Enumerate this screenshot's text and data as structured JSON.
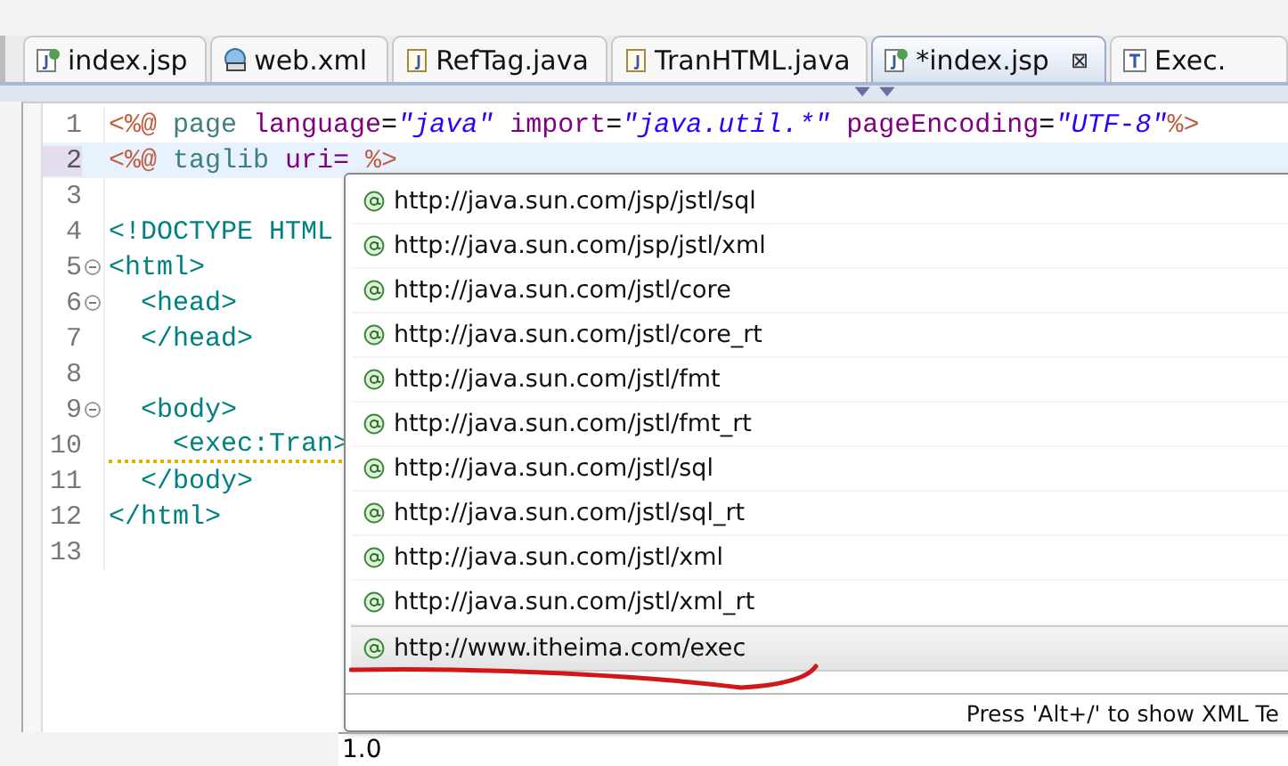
{
  "tabs": [
    {
      "label": "index.jsp",
      "kind": "jsp",
      "selected": false
    },
    {
      "label": "web.xml",
      "kind": "xml",
      "selected": false
    },
    {
      "label": "RefTag.java",
      "kind": "java",
      "selected": false
    },
    {
      "label": "TranHTML.java",
      "kind": "java",
      "selected": false
    },
    {
      "label": "*index.jsp",
      "kind": "jsp",
      "selected": true,
      "close": "⊠"
    },
    {
      "label": "Exec.",
      "kind": "tag",
      "selected": false
    }
  ],
  "editor": {
    "lines": [
      {
        "number": "1",
        "current": false,
        "foldable": false,
        "warning": false,
        "tokens": [
          {
            "kind": "delim",
            "text": "<%@"
          },
          {
            "kind": "directive",
            "text": " page"
          },
          {
            "kind": "attr",
            "text": " language"
          },
          {
            "kind": "plain",
            "text": "="
          },
          {
            "kind": "value",
            "text": "\"java\""
          },
          {
            "kind": "attr",
            "text": " import"
          },
          {
            "kind": "plain",
            "text": "="
          },
          {
            "kind": "value",
            "text": "\"java.util.*\""
          },
          {
            "kind": "attr",
            "text": " pageEncoding"
          },
          {
            "kind": "plain",
            "text": "="
          },
          {
            "kind": "value",
            "text": "\"UTF-8\""
          },
          {
            "kind": "delim",
            "text": "%>"
          }
        ]
      },
      {
        "number": "2",
        "current": true,
        "foldable": false,
        "warning": false,
        "tokens": [
          {
            "kind": "delim",
            "text": "<%@"
          },
          {
            "kind": "directive",
            "text": " taglib"
          },
          {
            "kind": "attr",
            "text": " uri="
          },
          {
            "kind": "delim",
            "text": " %>"
          }
        ]
      },
      {
        "number": "3",
        "current": false,
        "foldable": false
      },
      {
        "number": "4",
        "current": false,
        "foldable": false,
        "warning": false,
        "tokens": [
          {
            "kind": "tag",
            "text": "<!DOCTYPE HTML"
          }
        ]
      },
      {
        "number": "5",
        "current": false,
        "foldable": true,
        "warning": false,
        "tokens": [
          {
            "kind": "tag",
            "text": "<html>"
          }
        ]
      },
      {
        "number": "6",
        "current": false,
        "foldable": true,
        "warning": false,
        "tokens": [
          {
            "kind": "tag",
            "text": "  <head>"
          }
        ]
      },
      {
        "number": "7",
        "current": false,
        "foldable": false,
        "warning": false,
        "tokens": [
          {
            "kind": "tag",
            "text": "  </head>"
          }
        ]
      },
      {
        "number": "8",
        "current": false,
        "foldable": false
      },
      {
        "number": "9",
        "current": false,
        "foldable": true,
        "warning": false,
        "tokens": [
          {
            "kind": "tag",
            "text": "  <body>"
          }
        ]
      },
      {
        "number": "10",
        "current": false,
        "foldable": false,
        "warning": true,
        "tokens": [
          {
            "kind": "tag",
            "text": "    <exec:Tran>"
          }
        ]
      },
      {
        "number": "11",
        "current": false,
        "foldable": false,
        "warning": false,
        "tokens": [
          {
            "kind": "tag",
            "text": "  </body>"
          }
        ]
      },
      {
        "number": "12",
        "current": false,
        "foldable": false,
        "warning": false,
        "tokens": [
          {
            "kind": "tag",
            "text": "</html>"
          }
        ]
      },
      {
        "number": "13",
        "current": false,
        "foldable": false
      }
    ]
  },
  "completion": {
    "items": [
      {
        "label": "http://java.sun.com/jsp/jstl/sql",
        "selected": false
      },
      {
        "label": "http://java.sun.com/jsp/jstl/xml",
        "selected": false
      },
      {
        "label": "http://java.sun.com/jstl/core",
        "selected": false
      },
      {
        "label": "http://java.sun.com/jstl/core_rt",
        "selected": false
      },
      {
        "label": "http://java.sun.com/jstl/fmt",
        "selected": false
      },
      {
        "label": "http://java.sun.com/jstl/fmt_rt",
        "selected": false
      },
      {
        "label": "http://java.sun.com/jstl/sql",
        "selected": false
      },
      {
        "label": "http://java.sun.com/jstl/sql_rt",
        "selected": false
      },
      {
        "label": "http://java.sun.com/jstl/xml",
        "selected": false
      },
      {
        "label": "http://java.sun.com/jstl/xml_rt",
        "selected": false
      },
      {
        "label": "http://www.itheima.com/exec",
        "selected": true
      }
    ],
    "hint": "Press 'Alt+/' to show XML Te"
  },
  "status": "1.0"
}
